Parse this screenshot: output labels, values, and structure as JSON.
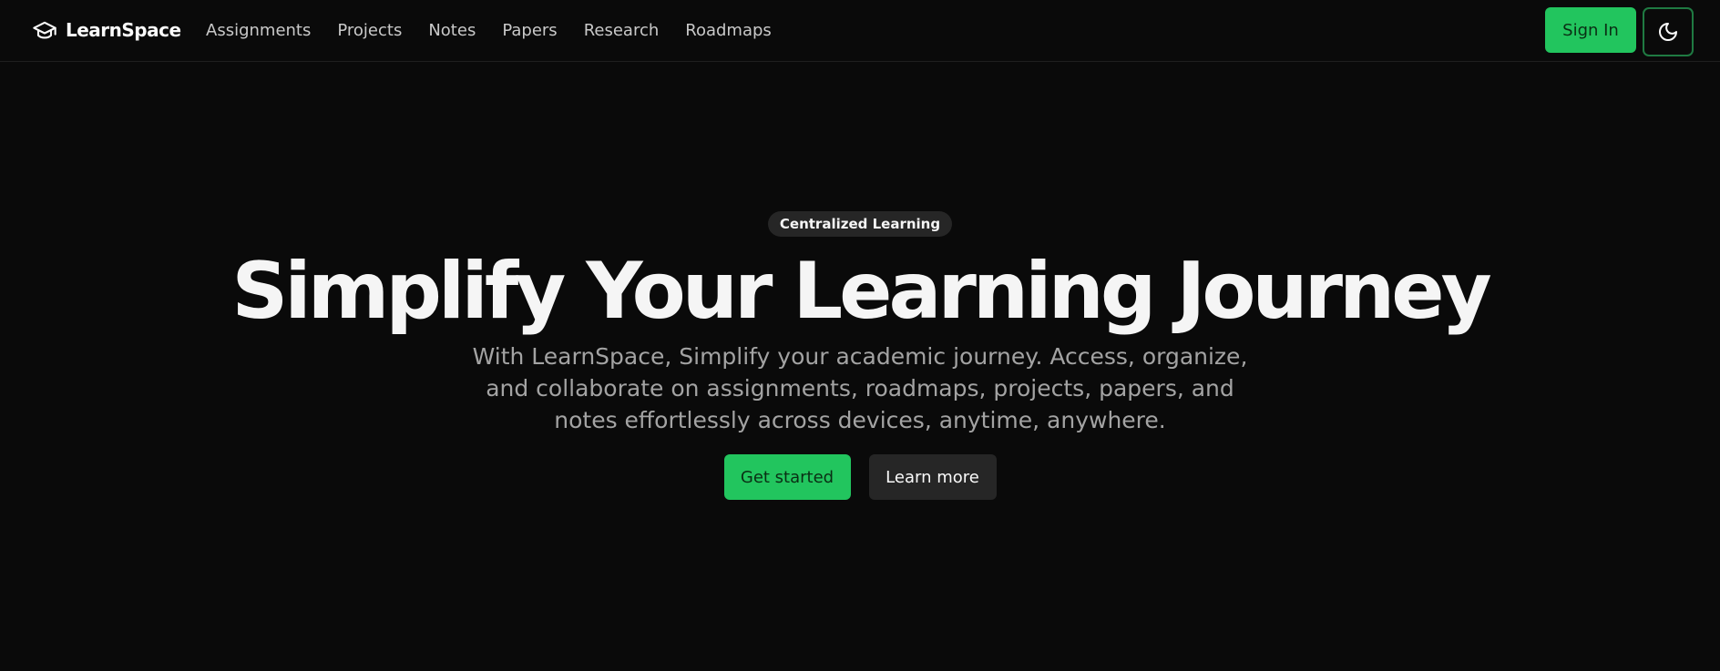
{
  "brand": {
    "name": "LearnSpace",
    "icon": "graduation-cap-icon"
  },
  "nav": {
    "links": [
      "Assignments",
      "Projects",
      "Notes",
      "Papers",
      "Research",
      "Roadmaps"
    ]
  },
  "header": {
    "signin_label": "Sign In",
    "theme_icon": "moon-icon"
  },
  "hero": {
    "badge": "Centralized Learning",
    "title": "Simplify Your Learning Journey",
    "description": "With LearnSpace, Simplify your academic journey. Access, organize, and collaborate on assignments, roadmaps, projects, papers, and notes effortlessly across devices, anytime, anywhere.",
    "primary_cta": "Get started",
    "secondary_cta": "Learn more"
  },
  "colors": {
    "background": "#0a0a0a",
    "accent": "#22c55e",
    "muted_text": "#a3a3a3",
    "secondary_button": "#262626"
  }
}
